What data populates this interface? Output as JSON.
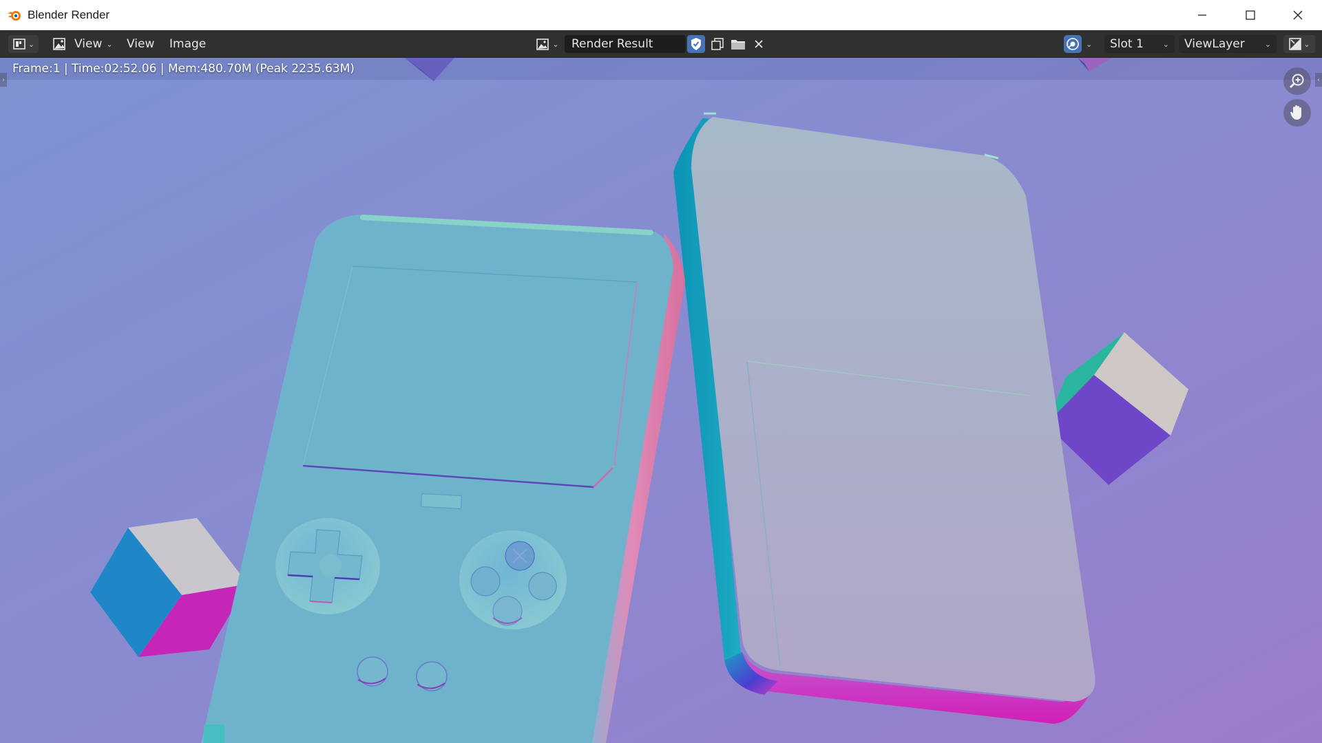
{
  "window": {
    "title": "Blender Render",
    "icon": "blender-logo-icon",
    "controls": [
      "minimize-icon",
      "maximize-icon",
      "close-icon"
    ]
  },
  "header": {
    "editor_type_icon": "image-editor-icon",
    "view_mode_icon": "view-mode-icon",
    "view_mode_label": "View",
    "menus": [
      "View",
      "Image"
    ],
    "image_browse_icon": "image-browse-icon",
    "image_name": "Render Result",
    "fake_user_icon": "shield-icon",
    "duplicate_icon": "duplicate-icon",
    "open_icon": "folder-icon",
    "unlink_icon": "close-icon",
    "gizmo_icon": "gizmo-icon",
    "slot": "Slot 1",
    "view_layer": "ViewLayer",
    "display_channels_icon": "display-channels-icon"
  },
  "render": {
    "stats": "Frame:1 | Time:02:52.06 | Mem:480.70M (Peak 2235.63M)"
  },
  "navigation": {
    "zoom_icon": "zoom-icon",
    "pan_icon": "hand-icon"
  },
  "colors": {
    "accent": "#4772b3",
    "header_bg": "#303030",
    "background_top": "#7c8fd0",
    "background_bottom": "#9078c8"
  }
}
